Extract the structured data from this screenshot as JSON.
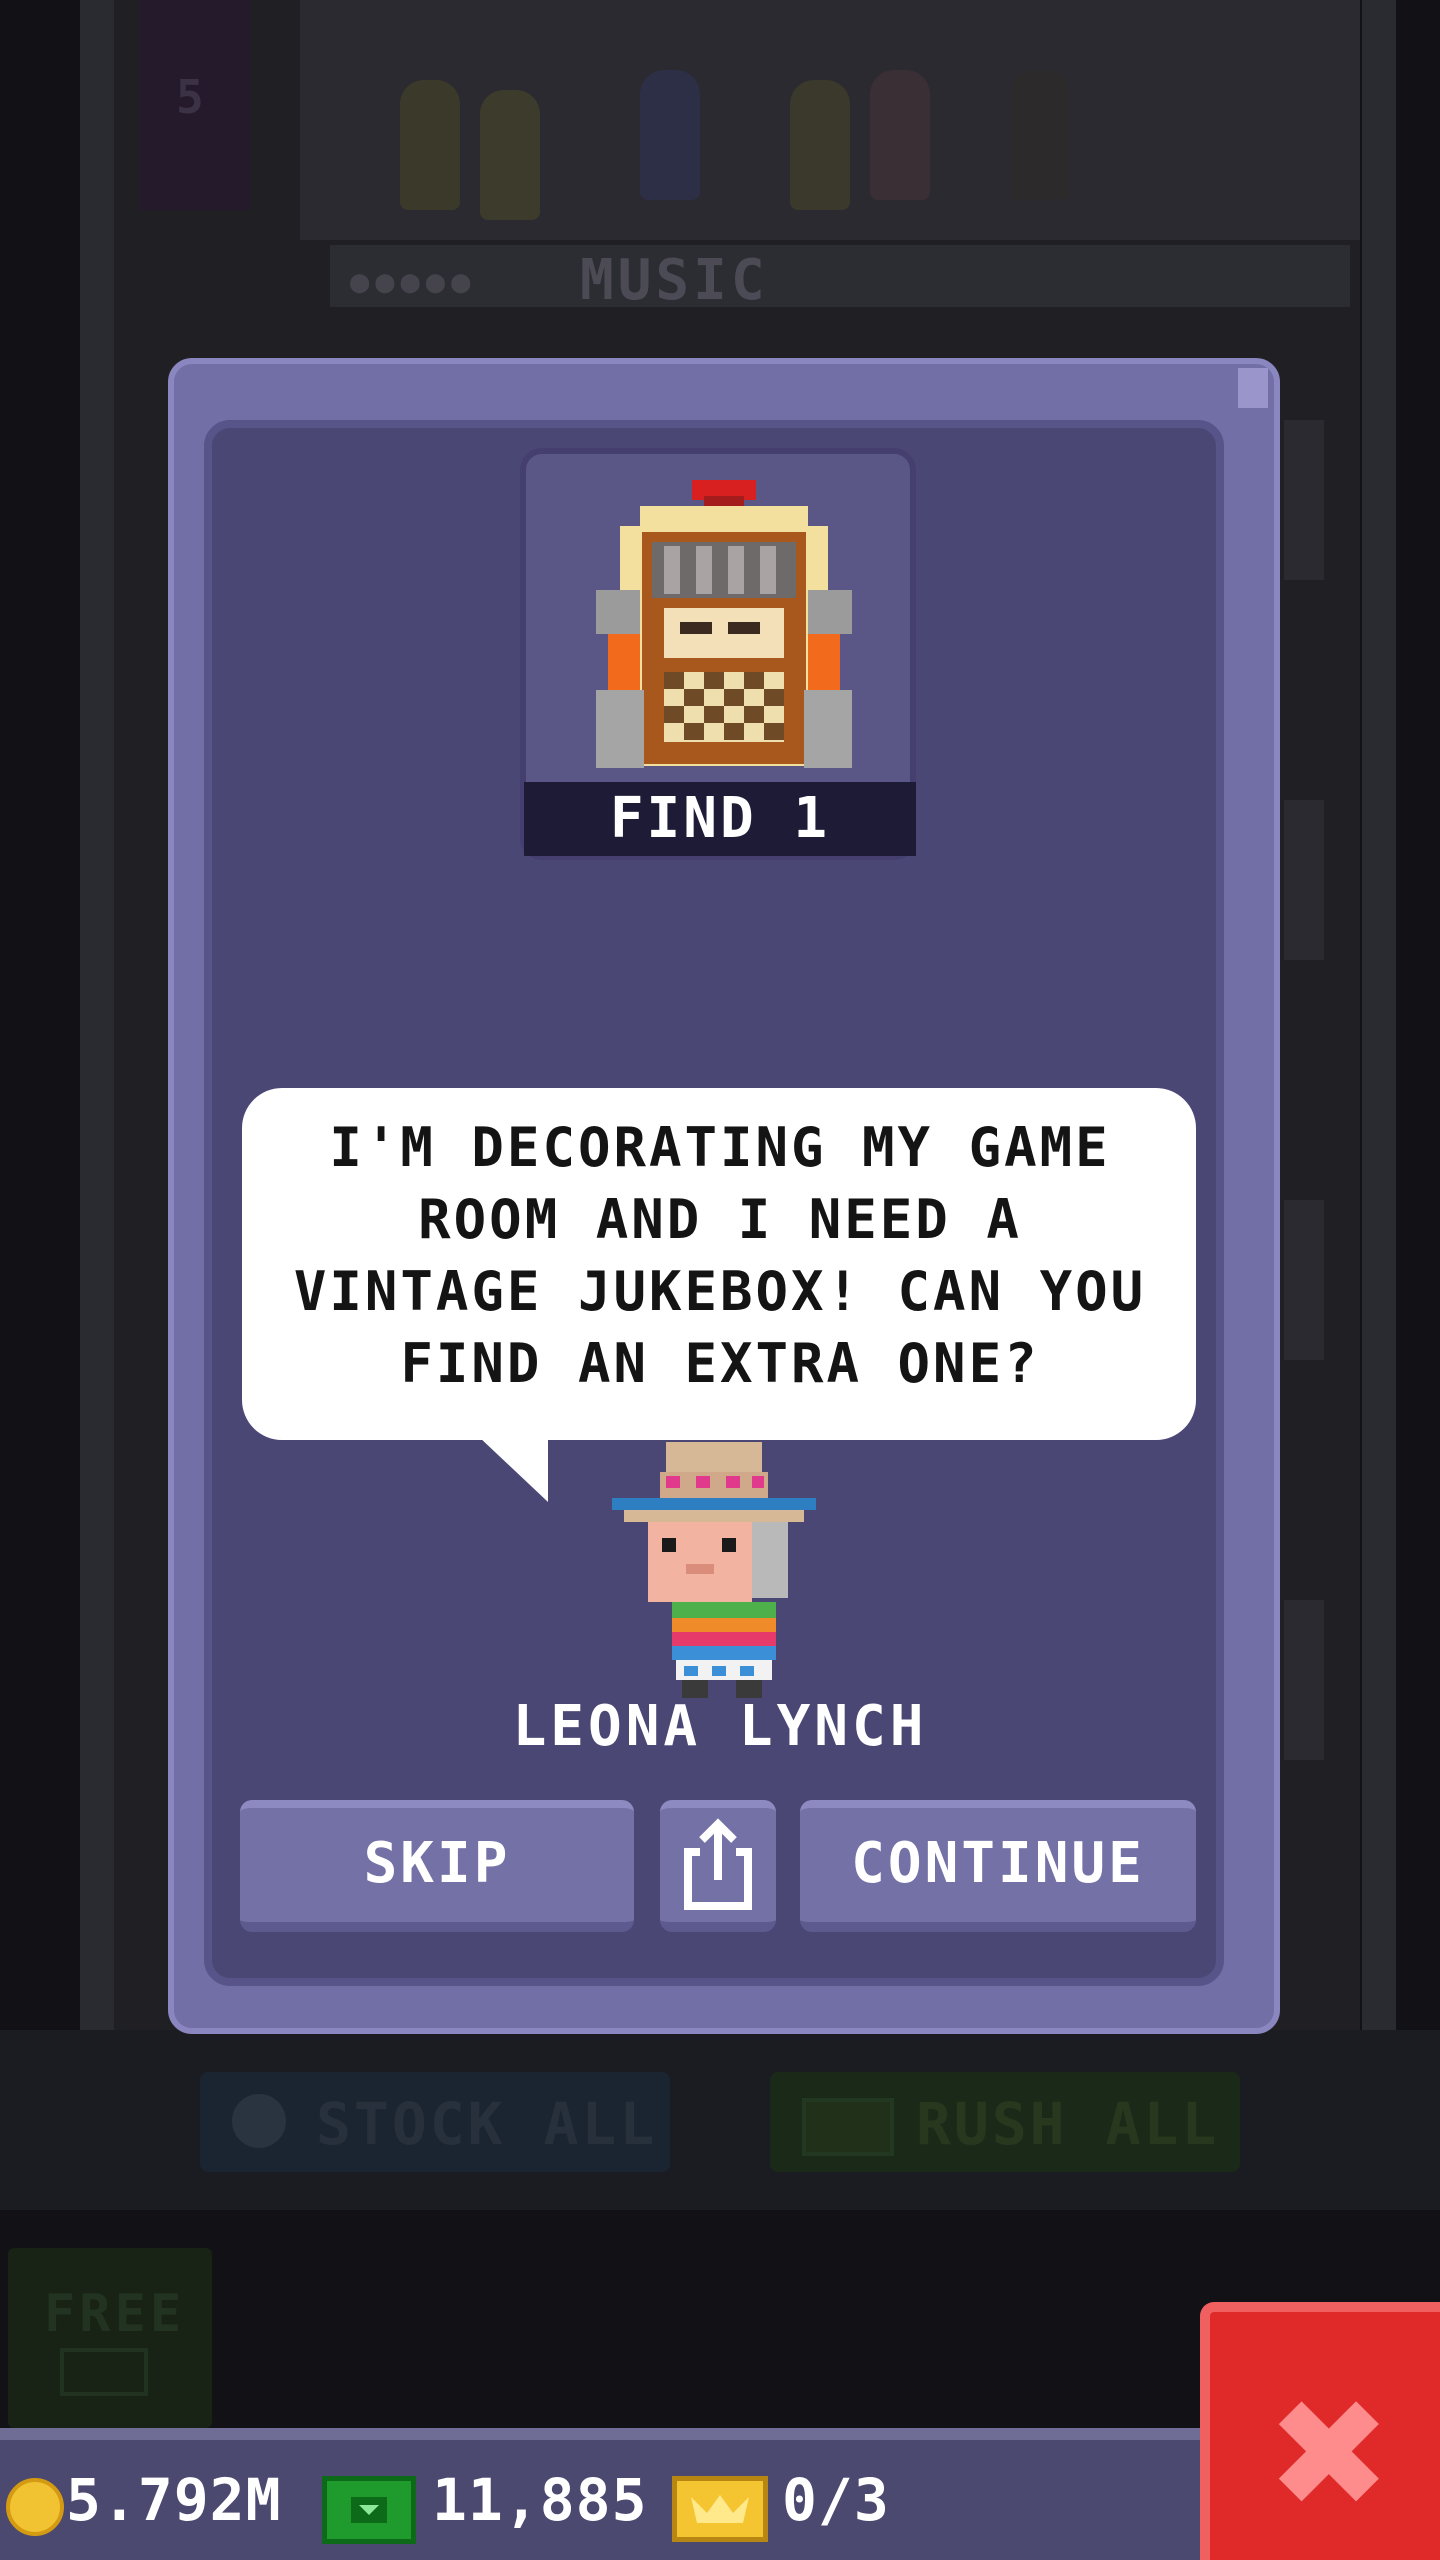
{
  "background": {
    "door_number": "5",
    "floor_sign": "MUSIC",
    "stock_all_label": "STOCK ALL",
    "rush_all_label": "RUSH ALL",
    "free_label": "FREE"
  },
  "currency": {
    "coins": "5.792M",
    "tower_bux": "11,885",
    "tickets": "0/3"
  },
  "dialog": {
    "item_name_icon": "jukebox-icon",
    "find_label": "FIND 1",
    "speech": "I'M DECORATING MY GAME ROOM AND I NEED A VINTAGE JUKEBOX! CAN YOU FIND AN EXTRA ONE?",
    "npc_name": "LEONA LYNCH",
    "buttons": {
      "skip": "SKIP",
      "share_icon": "share-icon",
      "continue": "CONTINUE"
    }
  },
  "colors": {
    "dialog_frame": "#726ea6",
    "dialog_inner": "#4a4775",
    "button": "#7371a6",
    "close_button": "#e02a2a",
    "coin": "#f1c232",
    "bux": "#1f9a2c",
    "ticket": "#f5c431"
  }
}
